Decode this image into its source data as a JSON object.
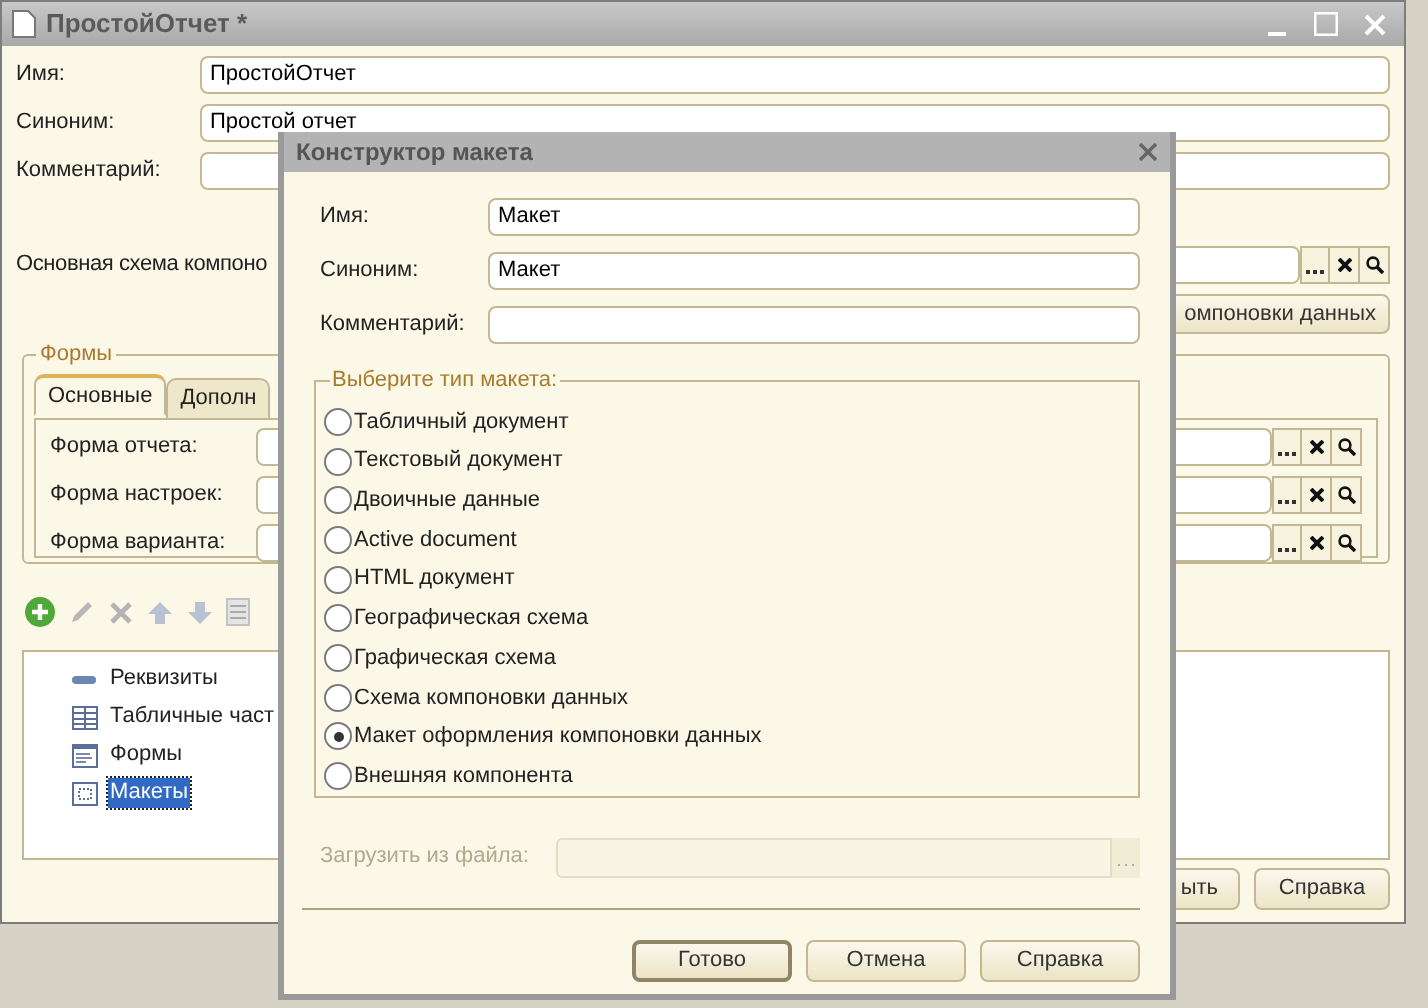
{
  "main_window": {
    "title": "ПростойОтчет *",
    "fields": [
      {
        "label": "Имя:",
        "value": "ПростойОтчет"
      },
      {
        "label": "Синоним:",
        "value": "Простой отчет"
      },
      {
        "label": "Комментарий:"
      }
    ],
    "schema": {
      "label": "Основная схема компоно"
    },
    "schema_button": "омпоновки данных",
    "forms_group": {
      "legend": "Формы",
      "tabs": [
        {
          "label": "Основные",
          "selected": true
        },
        {
          "label": "Дополн",
          "selected": false
        }
      ],
      "fields": [
        {
          "label": "Форма отчета:"
        },
        {
          "label": "Форма настроек:"
        },
        {
          "label": "Форма варианта:"
        }
      ]
    },
    "tree": {
      "items": [
        {
          "kind": "attributes",
          "label": "Реквизиты",
          "selected": false
        },
        {
          "kind": "tables",
          "label": "Табличные част",
          "selected": false
        },
        {
          "kind": "forms",
          "label": "Формы",
          "selected": false
        },
        {
          "kind": "templates",
          "label": "Макеты",
          "selected": true
        }
      ]
    },
    "buttons": [
      "ыть",
      "Справка"
    ]
  },
  "dialog": {
    "title": "Конструктор макета",
    "fields": [
      {
        "label": "Имя:",
        "value": "Макет"
      },
      {
        "label": "Синоним:",
        "value": "Макет"
      },
      {
        "label": "Комментарий:"
      }
    ],
    "group": {
      "legend": "Выберите тип макета:",
      "options": [
        {
          "label": "Табличный документ",
          "selected": false
        },
        {
          "label": "Текстовый документ",
          "selected": false
        },
        {
          "label": "Двоичные данные",
          "selected": false
        },
        {
          "label": "Active document",
          "selected": false
        },
        {
          "label": "HTML документ",
          "selected": false
        },
        {
          "label": "Географическая схема",
          "selected": false
        },
        {
          "label": "Графическая схема",
          "selected": false
        },
        {
          "label": "Схема компоновки данных",
          "selected": false
        },
        {
          "label": "Макет оформления компоновки данных",
          "selected": true
        },
        {
          "label": "Внешняя компонента",
          "selected": false
        }
      ]
    },
    "file": {
      "label": "Загрузить из файла:",
      "disabled": true
    },
    "buttons": [
      {
        "label": "Готово",
        "default": true
      },
      {
        "label": "Отмена",
        "default": false
      },
      {
        "label": "Справка",
        "default": false
      }
    ]
  }
}
